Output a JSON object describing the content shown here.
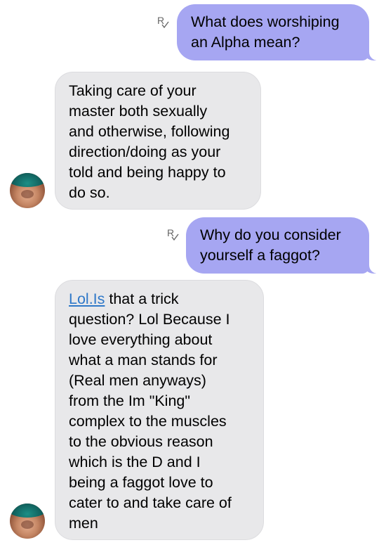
{
  "conversation": {
    "messages": [
      {
        "from": "me",
        "read_indicator": "R",
        "lines": [
          "What does worshiping",
          "an Alpha mean?"
        ]
      },
      {
        "from": "contact",
        "lines": [
          "Taking care of your",
          "master both sexually",
          "and otherwise, following",
          "direction/doing as your",
          "told and being happy to",
          "do so."
        ]
      },
      {
        "from": "me",
        "read_indicator": "R",
        "lines": [
          "Why do you consider",
          "yourself a faggot?"
        ]
      },
      {
        "from": "contact",
        "link_text": "Lol.Is",
        "lines": [
          " that a trick",
          "question?  Lol Because I",
          "love everything about",
          "what a man stands for",
          "(Real men anyways)",
          "from the Im \"King\"",
          "complex to the muscles",
          "to the obvious reason",
          "which is the D and I",
          "being a faggot love to",
          "cater to and take care of",
          "men"
        ]
      }
    ]
  },
  "colors": {
    "sent_bubble": "#a6a6f2",
    "received_bubble": "#e8e8ea",
    "link": "#2f78c8"
  }
}
